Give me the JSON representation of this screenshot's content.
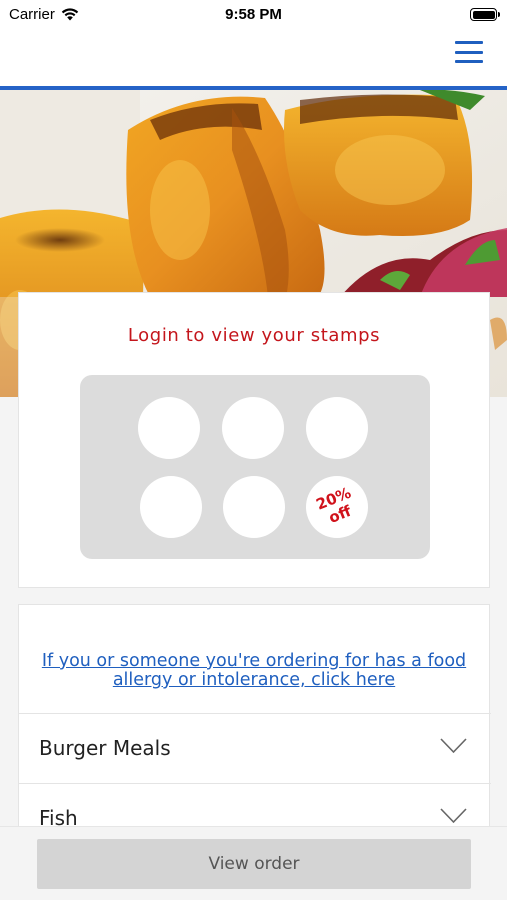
{
  "status_bar": {
    "carrier": "Carrier",
    "time": "9:58 PM",
    "icons": [
      "wifi-icon",
      "battery-icon"
    ]
  },
  "nav": {
    "menu_icon": "hamburger-menu-icon",
    "accent_color": "#2563c7"
  },
  "hero": {
    "image": "grilled-tikka-photo"
  },
  "stamps": {
    "title": "Login to view your stamps",
    "title_color": "#c4161c",
    "reward_text": "20%\noff",
    "reward_color": "#d0121b",
    "total": 6,
    "collected": 0
  },
  "menu": {
    "allergy_link": "If you or someone you're ordering for has a food allergy or intolerance, click here",
    "link_color": "#1f5fbf",
    "categories": [
      {
        "label": "Burger Meals",
        "icon": "chevron-down-icon"
      },
      {
        "label": "Fish",
        "icon": "chevron-down-icon"
      }
    ]
  },
  "footer": {
    "view_order_label": "View order"
  }
}
